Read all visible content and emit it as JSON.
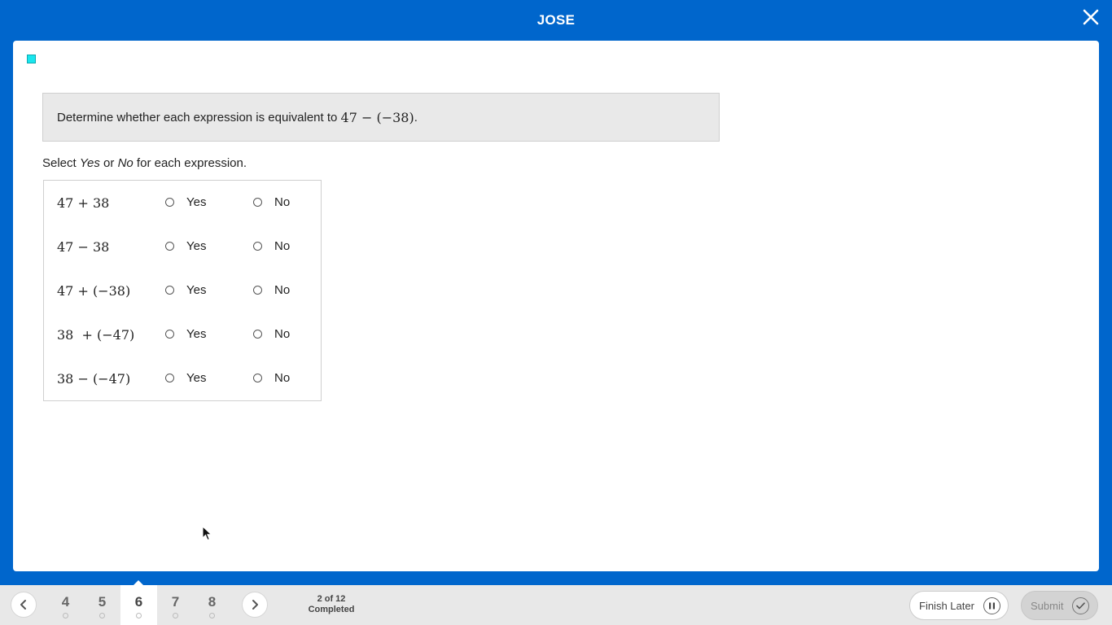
{
  "header": {
    "title": "JOSE",
    "close_icon": "close-icon"
  },
  "question": {
    "prompt_text": "Determine whether each expression is equivalent to ",
    "prompt_math": "47 − (−38)",
    "prompt_end": ".",
    "instruction_pre": "Select ",
    "instruction_yes": "Yes",
    "instruction_mid": " or ",
    "instruction_no": "No",
    "instruction_post": " for each expression."
  },
  "rows": [
    {
      "expr": "47 + 38",
      "yes": "Yes",
      "no": "No"
    },
    {
      "expr": "47 − 38",
      "yes": "Yes",
      "no": "No"
    },
    {
      "expr": "47 + (−38)",
      "yes": "Yes",
      "no": "No"
    },
    {
      "expr": "38  + (−47)",
      "yes": "Yes",
      "no": "No"
    },
    {
      "expr": "38 − (−47)",
      "yes": "Yes",
      "no": "No"
    }
  ],
  "footer": {
    "questions": [
      "4",
      "5",
      "6",
      "7",
      "8"
    ],
    "active_question": "6",
    "progress_line1": "2 of 12",
    "progress_line2": "Completed",
    "finish_later": "Finish Later",
    "submit": "Submit"
  },
  "colors": {
    "brand": "#0066cc",
    "flag": "#19e6ee"
  }
}
